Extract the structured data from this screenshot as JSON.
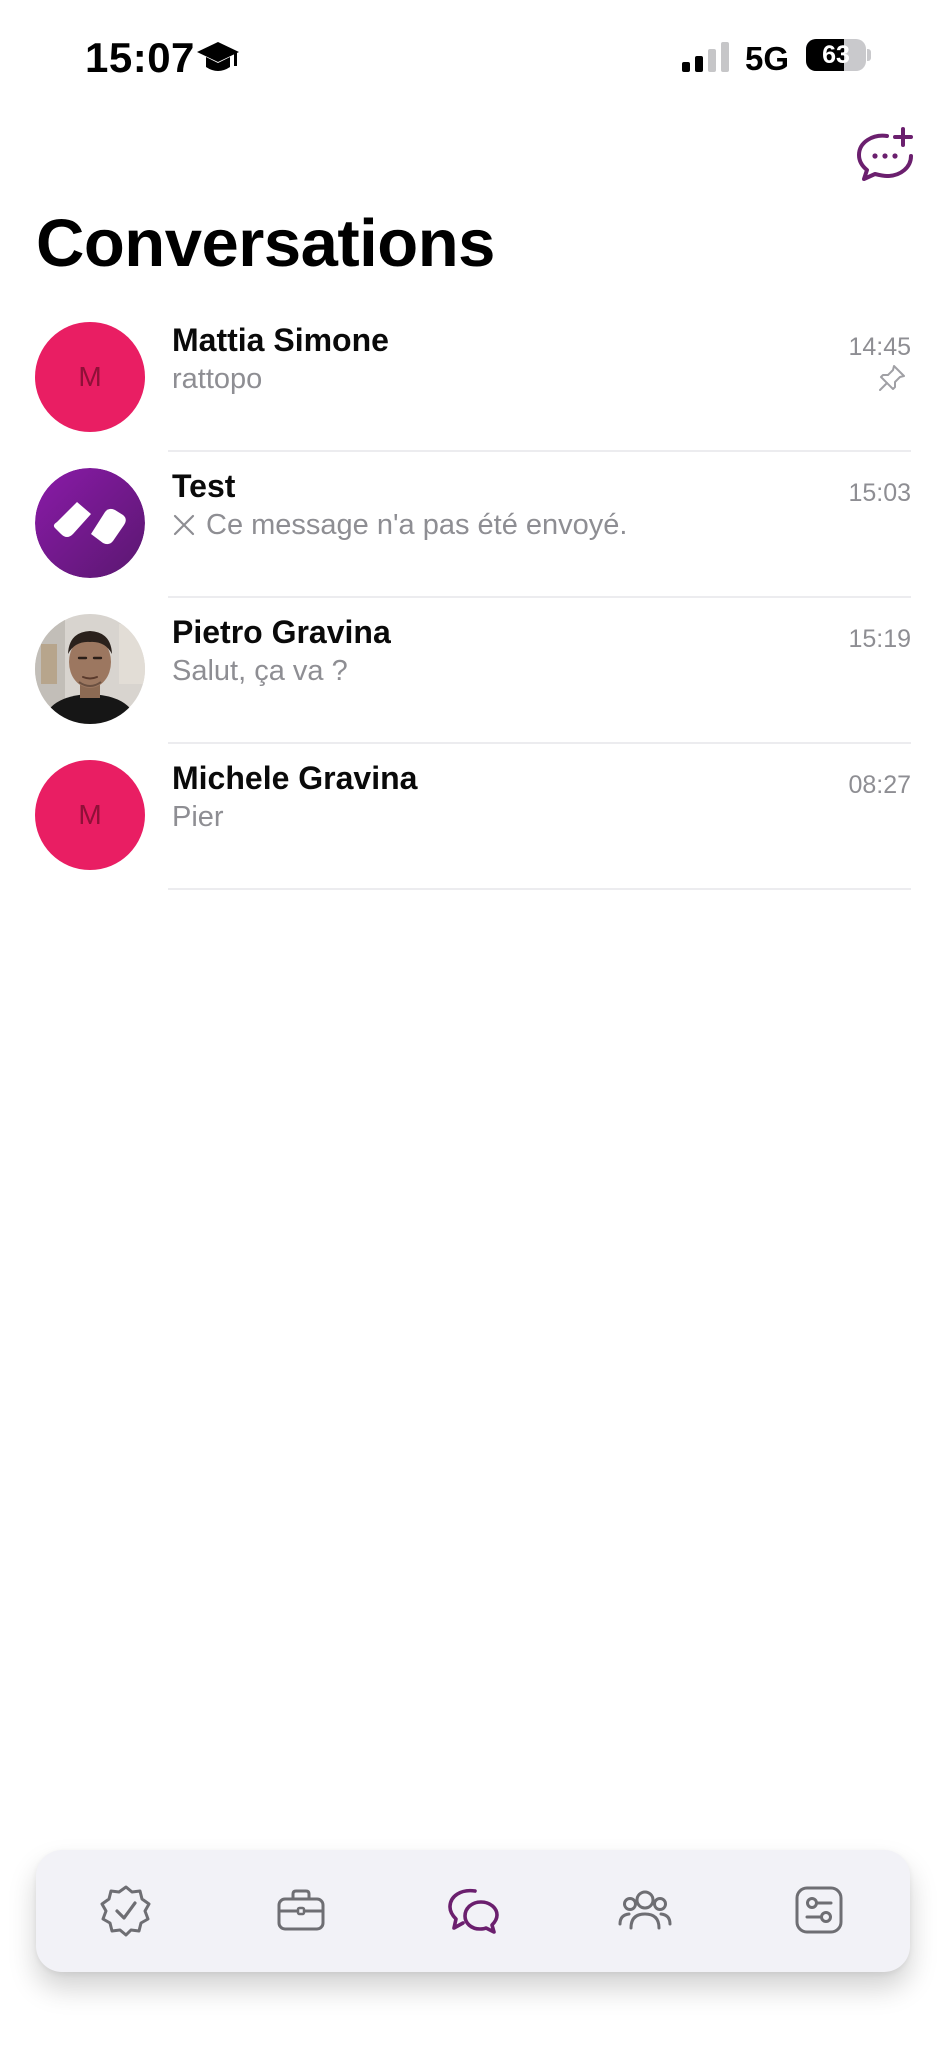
{
  "status_bar": {
    "time": "15:07",
    "network": "5G",
    "battery": "63",
    "battery_level": 0.63
  },
  "header": {
    "title": "Conversations",
    "new_chat_icon": "chat-plus-icon"
  },
  "conversations": [
    {
      "name": "Mattia Simone",
      "preview": "rattopo",
      "time": "14:45",
      "avatar_initial": "M",
      "pinned": true
    },
    {
      "name": "Test",
      "preview": "Ce message n'a pas été envoyé.",
      "time": "15:03",
      "failed": true
    },
    {
      "name": "Pietro Gravina",
      "preview": "Salut, ça va ?",
      "time": "15:19"
    },
    {
      "name": "Michele Gravina",
      "preview": "Pier",
      "time": "08:27",
      "avatar_initial": "M"
    }
  ],
  "tab_bar": {
    "tabs": [
      {
        "icon": "verified-badge-icon",
        "active": false
      },
      {
        "icon": "briefcase-icon",
        "active": false
      },
      {
        "icon": "chat-bubbles-icon",
        "active": true
      },
      {
        "icon": "people-icon",
        "active": false
      },
      {
        "icon": "settings-sliders-icon",
        "active": false
      }
    ]
  },
  "colors": {
    "accent": "#6b1f6e",
    "avatar_pink": "#e91e63",
    "secondary_text": "#8e8e93",
    "tab_bar_bg": "#f2f2f7",
    "inactive_icon": "#6e6e73"
  }
}
